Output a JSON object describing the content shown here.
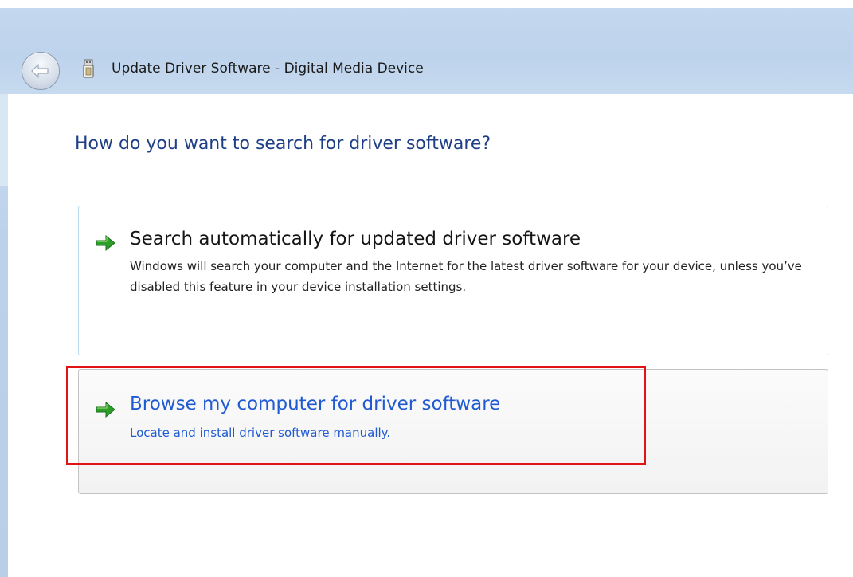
{
  "window": {
    "title": "Update Driver Software - Digital Media Device",
    "back_icon": "back-arrow-icon",
    "device_icon": "usb-device-icon"
  },
  "page": {
    "heading": "How do you want to search for driver software?"
  },
  "options": [
    {
      "title": "Search automatically for updated driver software",
      "description": "Windows will search your computer and the Internet for the latest driver software for your device, unless you’ve disabled this feature in your device installation settings.",
      "icon": "green-arrow-icon"
    },
    {
      "title": "Browse my computer for driver software",
      "description": "Locate and install driver software manually.",
      "icon": "green-arrow-icon"
    }
  ],
  "colors": {
    "heading": "#1e3f86",
    "link_blue": "#1f5ad1",
    "highlight_red": "#e01414",
    "arrow_green": "#2e9e2b",
    "titlebar": "#bdd3ec"
  }
}
